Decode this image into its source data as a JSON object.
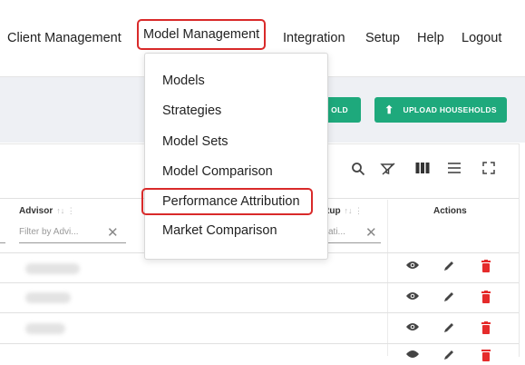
{
  "nav": {
    "items": [
      "Client Management",
      "Model Management",
      "Integration",
      "Setup",
      "Help",
      "Logout"
    ]
  },
  "buttons": {
    "add_household_partial": "OLD",
    "upload_households": "UPLOAD HOUSEHOLDS"
  },
  "dropdown": {
    "items": [
      "Models",
      "Strategies",
      "Model Sets",
      "Model Comparison",
      "Performance Attribution",
      "Market Comparison"
    ]
  },
  "table": {
    "columns": {
      "advisor": "Advisor",
      "setup_partial": "tup",
      "actions": "Actions"
    },
    "filters": {
      "advisor_placeholder": "Filter by Advi...",
      "setup_placeholder_partial": "ati..."
    }
  },
  "icons": {
    "toolbar": [
      "search-icon",
      "clear-filter-icon",
      "columns-icon",
      "density-icon",
      "fullscreen-icon"
    ],
    "row_actions": [
      "view-icon",
      "edit-icon",
      "delete-icon"
    ]
  },
  "colors": {
    "highlight_red": "#d92a2a",
    "primary_green": "#1ea97c",
    "delete_red": "#e52b2b"
  }
}
